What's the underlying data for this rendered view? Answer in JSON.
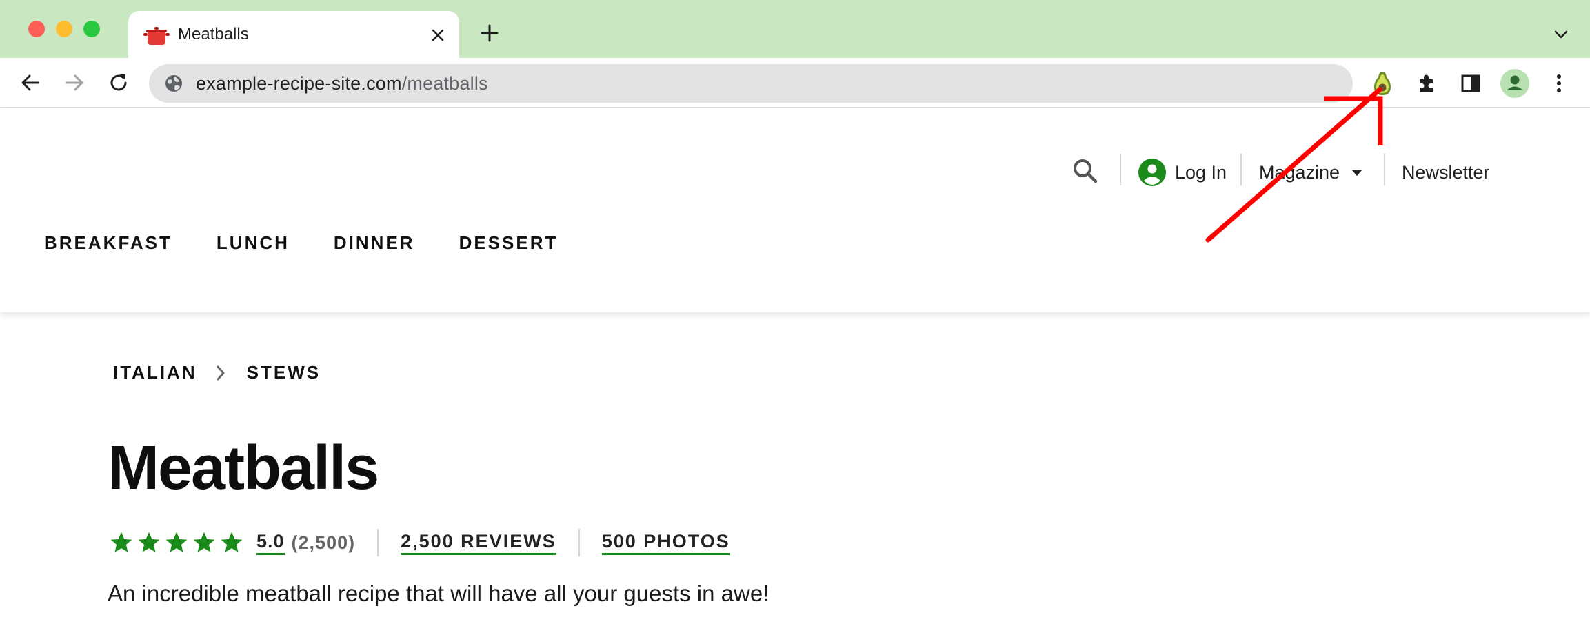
{
  "browser": {
    "tab": {
      "title": "Meatballs",
      "icon": "cooking-pot-icon"
    },
    "address_bar": {
      "host": "example-recipe-site.com",
      "path": "/meatballs"
    },
    "toolbar_icons": [
      "avocado-extension-icon",
      "extensions-puzzle-icon",
      "side-panel-icon",
      "profile-avatar-icon",
      "more-menu-icon"
    ]
  },
  "header": {
    "login_label": "Log In",
    "magazine_label": "Magazine",
    "newsletter_label": "Newsletter",
    "categories": [
      "BREAKFAST",
      "LUNCH",
      "DINNER",
      "DESSERT"
    ]
  },
  "breadcrumb": [
    "ITALIAN",
    "STEWS"
  ],
  "recipe": {
    "title": "Meatballs",
    "rating_value": "5.0",
    "rating_count": "(2,500)",
    "stars": 5,
    "reviews_label": "2,500 REVIEWS",
    "photos_label": "500 PHOTOS",
    "description": "An incredible meatball recipe that will have all your guests in awe!"
  },
  "colors": {
    "tab_strip": "#c9e8c1",
    "brand_green": "#1a8b1a",
    "annotation_red": "#ff0000"
  }
}
